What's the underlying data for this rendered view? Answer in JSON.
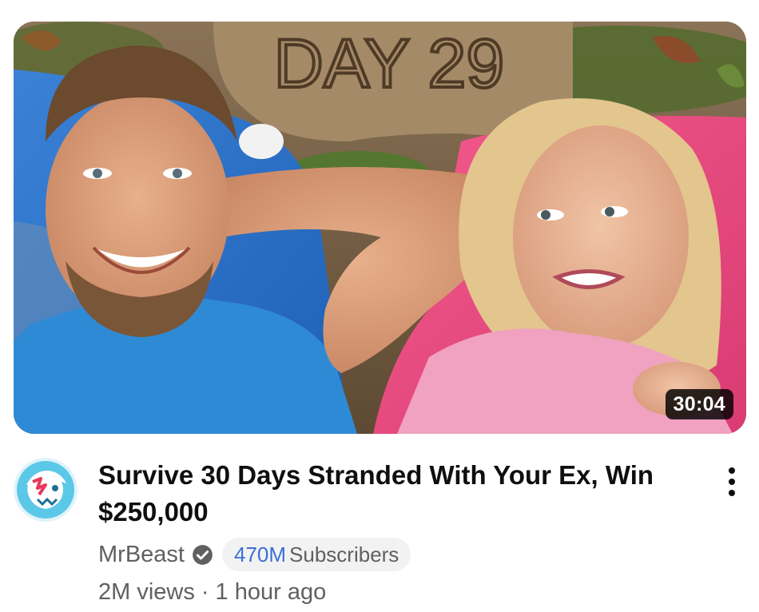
{
  "video": {
    "thumbnail_text": "DAY 29",
    "duration": "30:04",
    "title": "Survive 30 Days Stranded With Your Ex, Win $250,000",
    "views": "2M views",
    "separator": "·",
    "posted": "1 hour ago"
  },
  "channel": {
    "name": "MrBeast",
    "verified_icon": "verified-check-icon",
    "subscriber_count": "470M",
    "subscriber_label": "Subscribers"
  },
  "menu": {
    "icon": "more-vert-icon"
  },
  "colors": {
    "title": "#0f0f0f",
    "secondary": "#606060",
    "subscriber_count": "#3a6fd8",
    "pill_bg": "#f2f2f2",
    "avatar_accent": "#5bc8e8"
  }
}
